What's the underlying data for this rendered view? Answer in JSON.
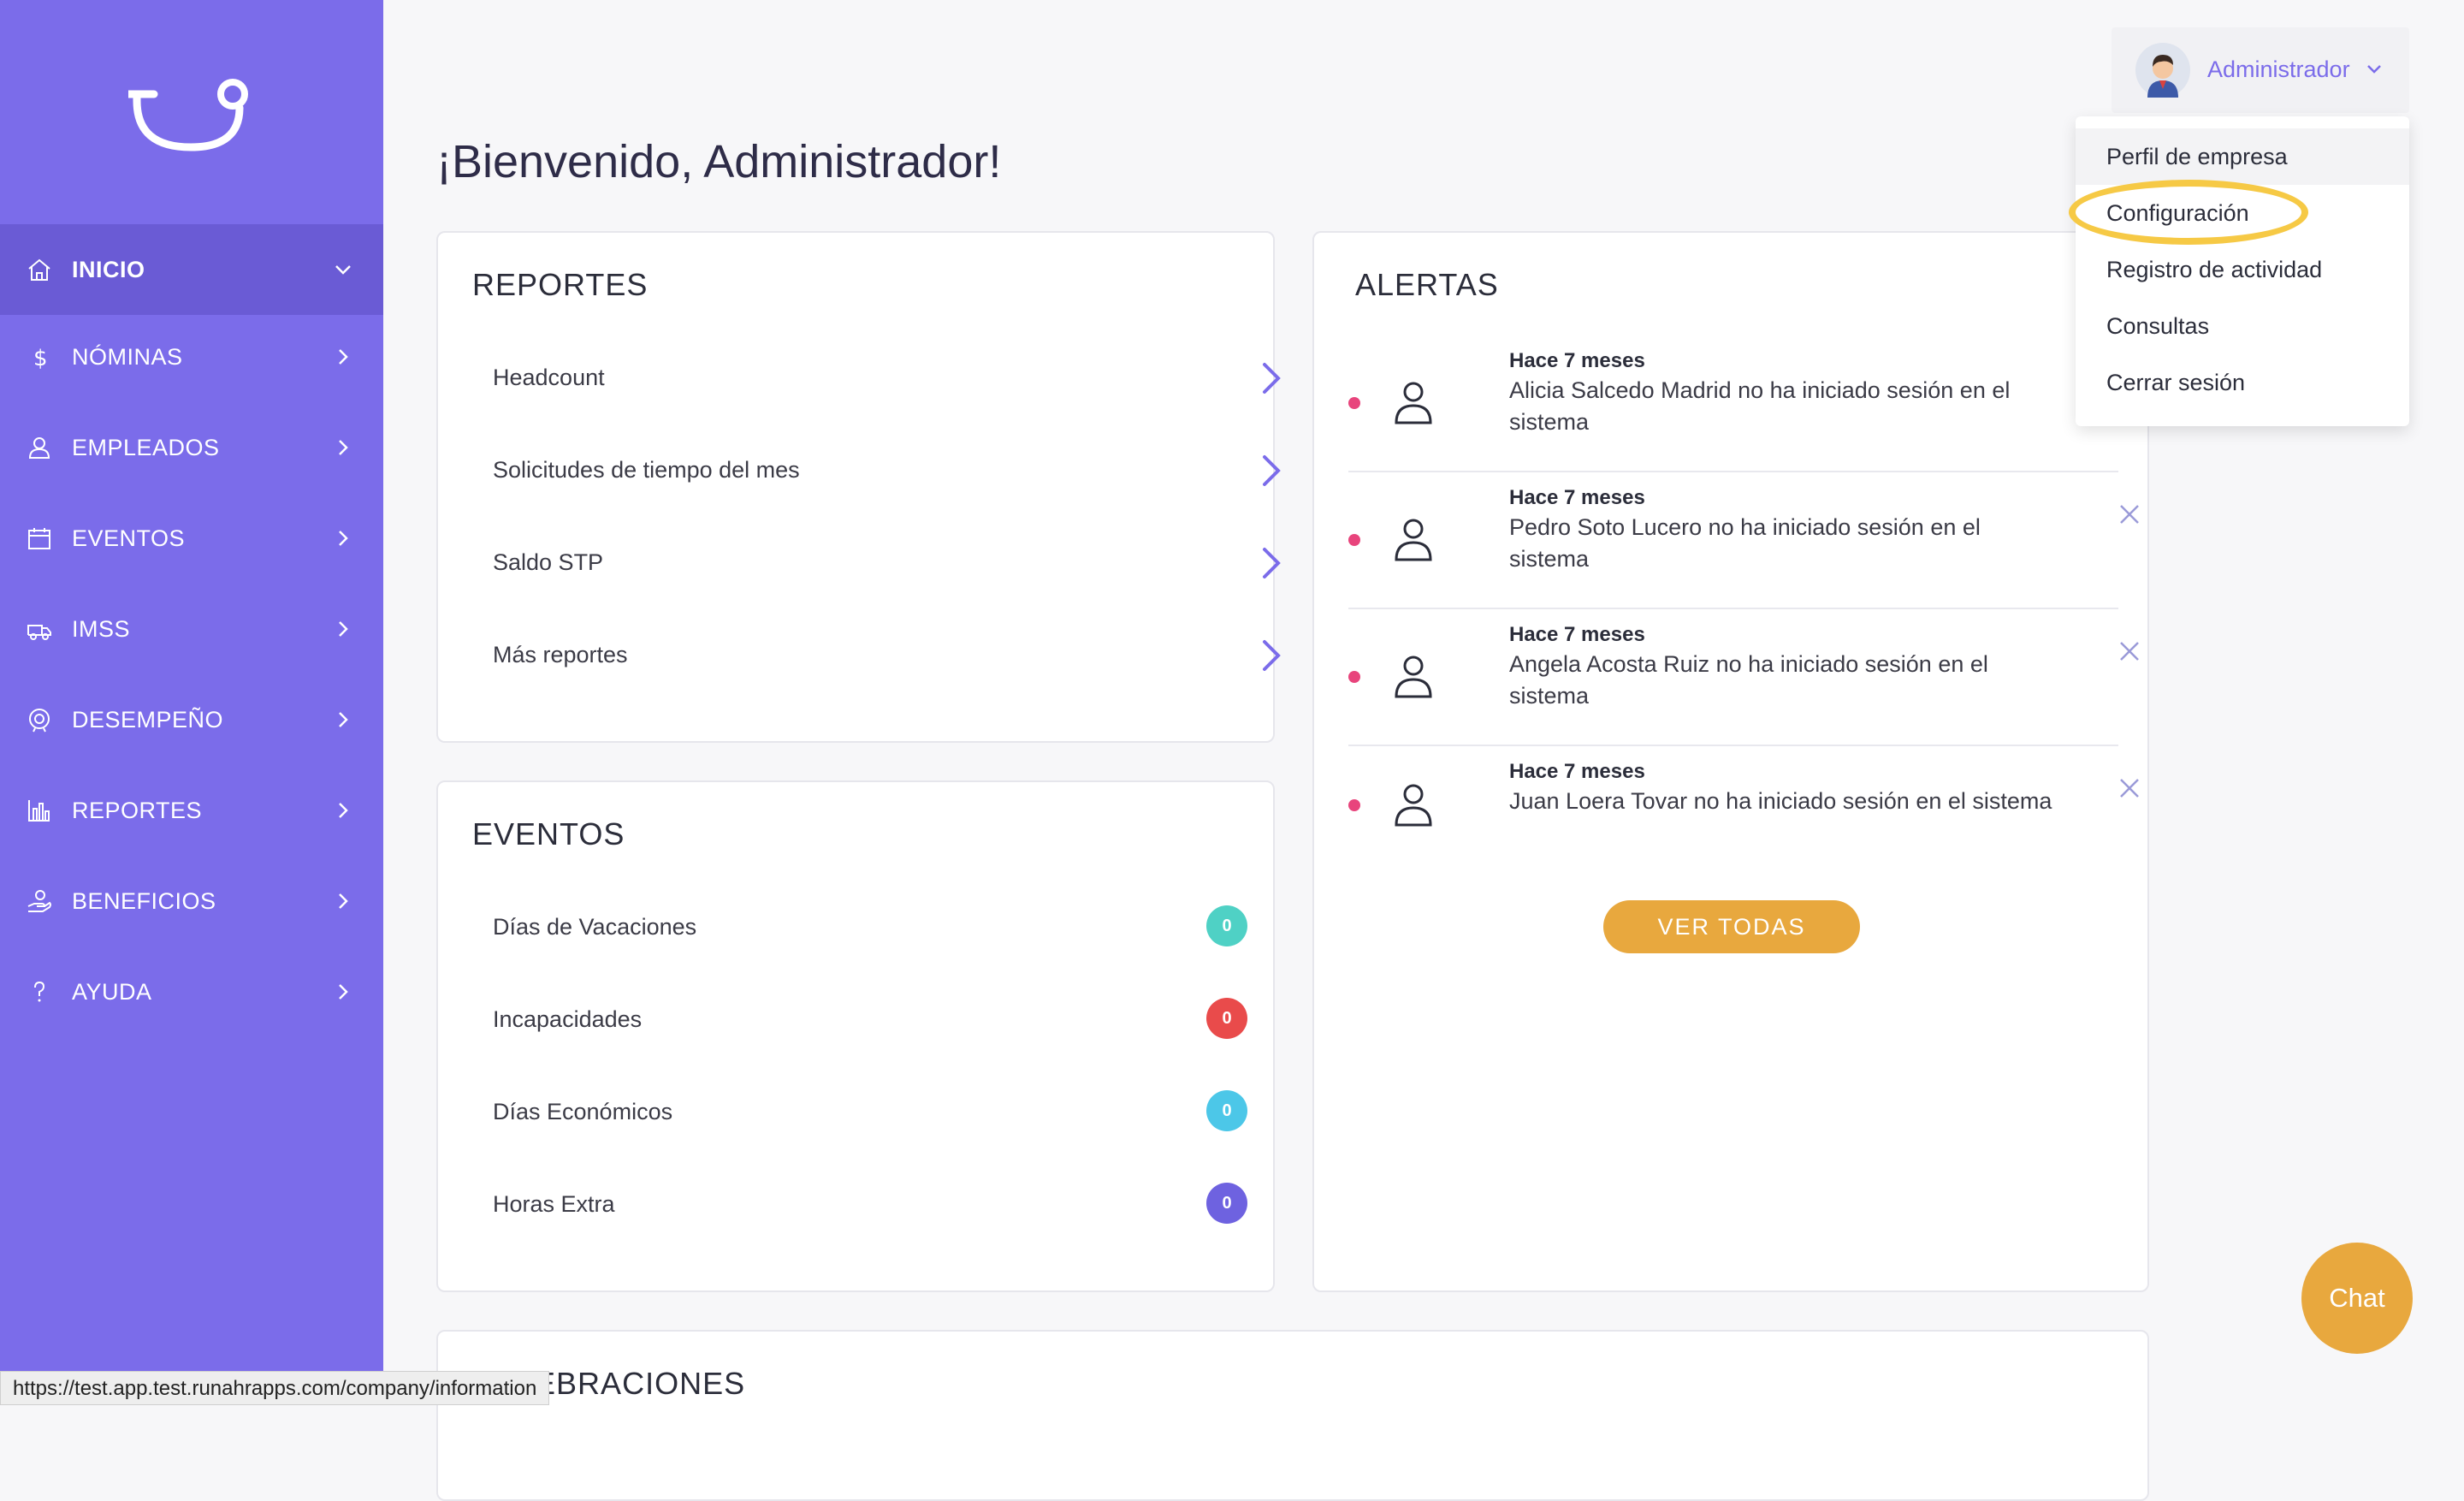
{
  "sidebar": {
    "items": [
      {
        "label": "INICIO",
        "icon": "home-icon",
        "active": true
      },
      {
        "label": "NÓMINAS",
        "icon": "dollar-icon"
      },
      {
        "label": "EMPLEADOS",
        "icon": "user-icon"
      },
      {
        "label": "EVENTOS",
        "icon": "calendar-icon"
      },
      {
        "label": "IMSS",
        "icon": "ambulance-icon"
      },
      {
        "label": "DESEMPEÑO",
        "icon": "performance-icon"
      },
      {
        "label": "REPORTES",
        "icon": "bar-chart-icon"
      },
      {
        "label": "BENEFICIOS",
        "icon": "benefits-icon"
      },
      {
        "label": "AYUDA",
        "icon": "question-icon"
      }
    ]
  },
  "header": {
    "welcome": "¡Bienvenido, Administrador!",
    "user_name": "Administrador"
  },
  "reportes": {
    "title": "REPORTES",
    "items": [
      {
        "label": "Headcount"
      },
      {
        "label": "Solicitudes de tiempo del mes"
      },
      {
        "label": "Saldo STP"
      },
      {
        "label": "Más reportes"
      }
    ]
  },
  "eventos": {
    "title": "EVENTOS",
    "items": [
      {
        "label": "Días de Vacaciones",
        "count": "0",
        "color": "#4fd1c5"
      },
      {
        "label": "Incapacidades",
        "count": "0",
        "color": "#e94b4b"
      },
      {
        "label": "Días Económicos",
        "count": "0",
        "color": "#4cc7e8"
      },
      {
        "label": "Horas Extra",
        "count": "0",
        "color": "#6e62e0"
      }
    ]
  },
  "celebraciones": {
    "title": "CELEBRACIONES"
  },
  "alertas": {
    "title": "ALERTAS",
    "items": [
      {
        "time": "Hace 7 meses",
        "message": "Alicia Salcedo Madrid no ha iniciado sesión en el sistema"
      },
      {
        "time": "Hace 7 meses",
        "message": "Pedro Soto Lucero no ha iniciado sesión en el sistema"
      },
      {
        "time": "Hace 7 meses",
        "message": "Angela Acosta Ruiz no ha iniciado sesión en el sistema"
      },
      {
        "time": "Hace 7 meses",
        "message": "Juan Loera Tovar no ha iniciado sesión en el sistema"
      }
    ],
    "button": "VER TODAS"
  },
  "dropdown": {
    "items": [
      {
        "label": "Perfil de empresa"
      },
      {
        "label": "Configuración"
      },
      {
        "label": "Registro de actividad"
      },
      {
        "label": "Consultas"
      },
      {
        "label": "Cerrar sesión"
      }
    ]
  },
  "chat": {
    "label": "Chat"
  },
  "status_url": "https://test.app.test.runahrapps.com/company/information",
  "colors": {
    "sidebar": "#7b6cea",
    "sidebar_active": "#6a5bd5",
    "accent": "#7b6cea",
    "orange": "#e8a83e",
    "highlight": "#f6c945",
    "alert_dot": "#e8447c"
  }
}
